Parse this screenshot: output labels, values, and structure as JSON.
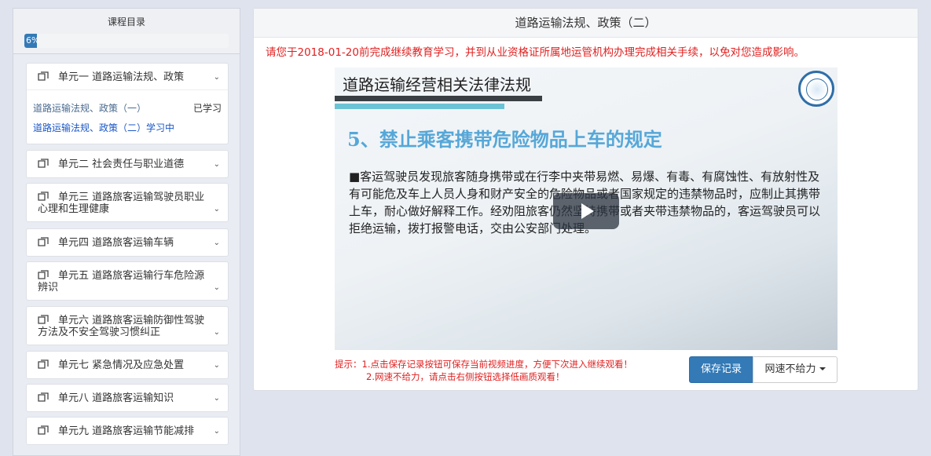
{
  "sidebar": {
    "title": "课程目录",
    "progress": {
      "percent": 6,
      "label": "6%"
    },
    "units": [
      {
        "title": "单元一 道路运输法规、政策",
        "lessons": [
          {
            "title": "道路运输法规、政策（一）",
            "status": "已学习"
          },
          {
            "title": "道路运输法规、政策（二）",
            "status": "学习中"
          }
        ]
      },
      {
        "title": "单元二 社会责任与职业道德"
      },
      {
        "title": "单元三 道路旅客运输驾驶员职业心理和生理健康"
      },
      {
        "title": "单元四 道路旅客运输车辆"
      },
      {
        "title": "单元五 道路旅客运输行车危险源辨识"
      },
      {
        "title": "单元六 道路旅客运输防御性驾驶方法及不安全驾驶习惯纠正"
      },
      {
        "title": "单元七 紧急情况及应急处置"
      },
      {
        "title": "单元八 道路旅客运输知识"
      },
      {
        "title": "单元九 道路旅客运输节能减排"
      }
    ]
  },
  "main": {
    "title": "道路运输法规、政策（二）",
    "notice": "请您于2018-01-20前完成继续教育学习，并到从业资格证所属地运管机构办理完成相关手续，以免对您造成影响。",
    "slide": {
      "heading": "道路运输经营相关法律法规",
      "subtitle": "5、禁止乘客携带危险物品上车的规定",
      "body": "■客运驾驶员发现旅客随身携带或在行李中夹带易燃、易爆、有毒、有腐蚀性、有放射性及有可能危及车上人员人身和财产安全的危险物品或者国家规定的违禁物品时，应制止其携带上车，耐心做好解释工作。经劝阻旅客仍然坚持携带或者夹带违禁物品的，客运驾驶员可以拒绝运输，拨打报警电话，交由公安部门处理。"
    },
    "tips": {
      "line1": "提示：1.点击保存记录按钮可保存当前视频进度，方便下次进入继续观看！",
      "line2": "2.网速不给力，请点击右侧按钮选择低画质观看！"
    },
    "save_label": "保存记录",
    "speed_label": "网速不给力"
  },
  "colors": {
    "accent": "#337ab7",
    "notice": "#e02020",
    "slide_subtitle": "#56a7d8",
    "status_blue": "#1a57c7"
  }
}
